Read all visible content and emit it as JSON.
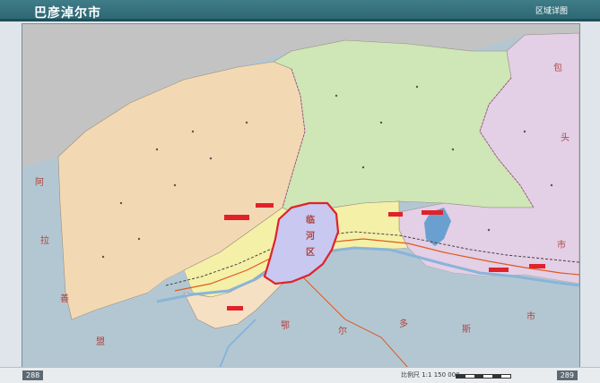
{
  "header": {
    "title": "巴彦淖尔市",
    "right_label": "区域详图"
  },
  "map": {
    "highlight_region": {
      "name": "临河区",
      "chars": [
        "临",
        "河",
        "区"
      ]
    },
    "province_labels": [
      {
        "text": "阿"
      },
      {
        "text": "拉"
      },
      {
        "text": "善"
      },
      {
        "text": "盟"
      },
      {
        "text": "鄂"
      },
      {
        "text": "尔"
      },
      {
        "text": "多"
      },
      {
        "text": "斯"
      },
      {
        "text": "市"
      },
      {
        "text": "包"
      },
      {
        "text": "头"
      },
      {
        "text": "市"
      }
    ],
    "colors": {
      "west_county": "#f3d9b3",
      "north_county": "#cfe6b7",
      "east_county": "#e3cfe6",
      "central_county": "#f5f0a8",
      "south_plain": "#f6e0c3",
      "outside_land": "#b3c7d3",
      "mongolia": "#c3c3c3",
      "river": "#8ab4d8",
      "lake": "#6aa0d0",
      "highlight_border": "#e0222a",
      "highlight_fill": "#c8c8f0",
      "railway": "#444444",
      "highway": "#e05a20"
    }
  },
  "footer": {
    "page_left": "288",
    "scale_text": "比例尺 1:1 150 000",
    "page_right": "289"
  }
}
